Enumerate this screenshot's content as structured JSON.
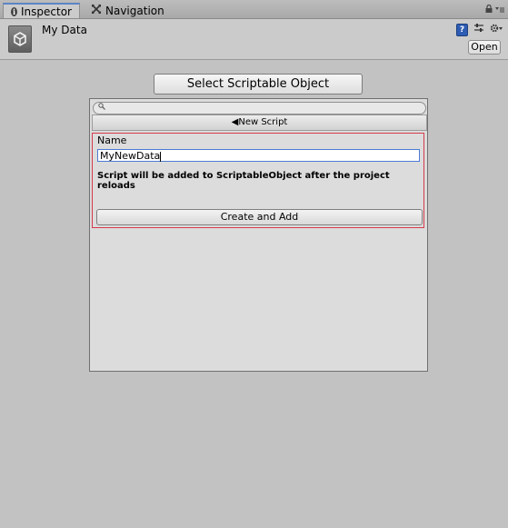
{
  "tabs": [
    {
      "label": "Inspector",
      "icon": "info-icon",
      "active": true
    },
    {
      "label": "Navigation",
      "icon": "navigation-icon",
      "active": false
    }
  ],
  "header": {
    "title": "My Data",
    "open_label": "Open"
  },
  "select_button_label": "Select Scriptable Object",
  "panel": {
    "search_placeholder": "",
    "new_script_label": "New Script",
    "name_label": "Name",
    "name_value": "MyNewData",
    "note": "Script will be added to ScriptableObject after the project reloads",
    "create_button_label": "Create and Add"
  },
  "colors": {
    "highlight_border": "#d43a4c",
    "active_tab_accent": "#5a85c5",
    "input_focus": "#4c7bd2"
  }
}
